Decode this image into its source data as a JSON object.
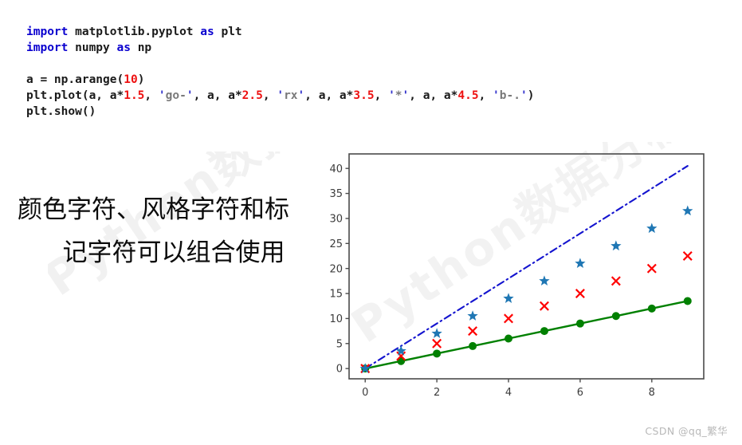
{
  "code": {
    "language": "python",
    "lines": [
      [
        {
          "t": "import",
          "c": "kw"
        },
        {
          "t": " matplotlib.pyplot ",
          "c": "plain"
        },
        {
          "t": "as",
          "c": "kw"
        },
        {
          "t": " plt",
          "c": "plain"
        }
      ],
      [
        {
          "t": "import",
          "c": "kw"
        },
        {
          "t": " numpy ",
          "c": "plain"
        },
        {
          "t": "as",
          "c": "kw"
        },
        {
          "t": " np",
          "c": "plain"
        }
      ],
      [],
      [
        {
          "t": "a = np.arange(",
          "c": "plain"
        },
        {
          "t": "10",
          "c": "num"
        },
        {
          "t": ")",
          "c": "plain"
        }
      ],
      [
        {
          "t": "plt.plot(a, a*",
          "c": "plain"
        },
        {
          "t": "1.5",
          "c": "num"
        },
        {
          "t": ", ",
          "c": "plain"
        },
        {
          "t": "'",
          "c": "quote"
        },
        {
          "t": "go-",
          "c": "str"
        },
        {
          "t": "'",
          "c": "quote"
        },
        {
          "t": ", a, a*",
          "c": "plain"
        },
        {
          "t": "2.5",
          "c": "num"
        },
        {
          "t": ", ",
          "c": "plain"
        },
        {
          "t": "'",
          "c": "quote"
        },
        {
          "t": "rx",
          "c": "str"
        },
        {
          "t": "'",
          "c": "quote"
        },
        {
          "t": ", a, a*",
          "c": "plain"
        },
        {
          "t": "3.5",
          "c": "num"
        },
        {
          "t": ", ",
          "c": "plain"
        },
        {
          "t": "'",
          "c": "quote"
        },
        {
          "t": "*",
          "c": "str"
        },
        {
          "t": "'",
          "c": "quote"
        },
        {
          "t": ", a, a*",
          "c": "plain"
        },
        {
          "t": "4.5",
          "c": "num"
        },
        {
          "t": ", ",
          "c": "plain"
        },
        {
          "t": "'",
          "c": "quote"
        },
        {
          "t": "b-.",
          "c": "str"
        },
        {
          "t": "'",
          "c": "quote"
        },
        {
          "t": ")",
          "c": "plain"
        }
      ],
      [
        {
          "t": "plt.show()",
          "c": "plain"
        }
      ]
    ]
  },
  "caption": {
    "line1": "颜色字符、风格字符和标",
    "line2": "记字符可以组合使用"
  },
  "watermarks": {
    "diagonal": "Python数据分析与展示",
    "footer": "CSDN @qq_繁华"
  },
  "colors": {
    "keyword": "#0a00cf",
    "number": "#ee1111",
    "string": "#7a7a7a",
    "quote": "#3333cc",
    "green_series": "#008000",
    "red_series": "#ff0000",
    "star_series": "#1f77b4",
    "blue_line": "#1414cf",
    "axis": "#4a4a4a",
    "tick_label": "#3c3c3c"
  },
  "chart_data": {
    "type": "scatter",
    "title": "",
    "xlabel": "",
    "ylabel": "",
    "x": [
      0,
      1,
      2,
      3,
      4,
      5,
      6,
      7,
      8,
      9
    ],
    "xlim": [
      -0.45,
      9.45
    ],
    "ylim": [
      -2.05,
      42.9
    ],
    "xticks": [
      0,
      2,
      4,
      6,
      8
    ],
    "yticks": [
      0,
      5,
      10,
      15,
      20,
      25,
      30,
      35,
      40
    ],
    "grid": false,
    "legend": "none",
    "series": [
      {
        "name": "a*1.5",
        "fmt": "go-",
        "color": "#008000",
        "marker": "circle",
        "linestyle": "solid",
        "values": [
          0,
          1.5,
          3,
          4.5,
          6,
          7.5,
          9,
          10.5,
          12,
          13.5
        ]
      },
      {
        "name": "a*2.5",
        "fmt": "rx",
        "color": "#ff0000",
        "marker": "x",
        "linestyle": "none",
        "values": [
          0,
          2.5,
          5,
          7.5,
          10,
          12.5,
          15,
          17.5,
          20,
          22.5
        ]
      },
      {
        "name": "a*3.5",
        "fmt": "*",
        "color": "#1f77b4",
        "marker": "star",
        "linestyle": "none",
        "values": [
          0,
          3.5,
          7,
          10.5,
          14,
          17.5,
          21,
          24.5,
          28,
          31.5
        ]
      },
      {
        "name": "a*4.5",
        "fmt": "b-.",
        "color": "#1414cf",
        "marker": "none",
        "linestyle": "dashdot",
        "values": [
          0,
          4.5,
          9,
          13.5,
          18,
          22.5,
          27,
          31.5,
          36,
          40.5
        ]
      }
    ]
  }
}
